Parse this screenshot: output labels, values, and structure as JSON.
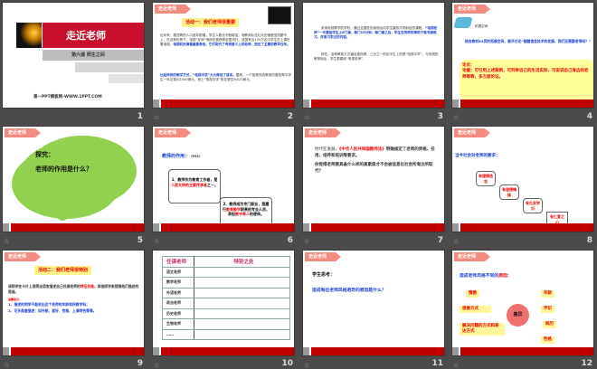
{
  "slide_numbers": [
    "1",
    "2",
    "3",
    "4",
    "5",
    "6",
    "7",
    "8",
    "9",
    "10",
    "11",
    "12"
  ],
  "section_tag": "走近老师",
  "s1": {
    "title": "走近老师",
    "subtitle": "第六课 师生之间",
    "footer": "第一PPT模板网-WWW.1PPT.COM"
  },
  "s2": {
    "heading": "活动一：我们老师很重要",
    "p1": "近年来，墨西哥的人口逐年剧增，学生人数也不断增加，而教师队伍壮大的速度显然跟不上。在这种形势下，电视“老师”悄然在墨西哥全国流行。该国有近130万名中学生在上课时看电视。",
    "p1b": "电视机扮演着重要角色，它们取代了传统意义上的老师，担任了主要的教学任务。",
    "p2b": "比起传统的教学方式，“电视中学”大大降低了成本。",
    "p2": "据悉，一个接受传统教育的墨西哥中学生一年花费约1000美元，而上“电视中学”的花费仅为525美元。"
  },
  "s3": {
    "p1": "采用电视教学的学校，通过全国性的电视台向学生播放不同科目的课程。",
    "p1b": "“电视老师”一天要给学生上6门课，每门15分钟，每门课之后，学生在导师的帮助下做书面练习，并复习学过的内容。",
    "p2": "现在，这种教育方式遍及墨西哥，三分之一的初中生上的是“电视中学”。与传统的教育相比，学生更喜欢“电视老师”。"
  },
  "s4": {
    "label": "拓展空间",
    "question": "结合教材64页的拓展空间，展开讨论“随着信息技术的发展，我们还需要老师吗？”",
    "point": "论点：",
    "evidence": "论据：可引用上述案例，可列举自己的生活实际，可说说自己身边的老师等等，多方面论证。"
  },
  "s5": {
    "line1": "探究：",
    "line2": "老师的作用是什么？"
  },
  "s6": {
    "heading": "教师的作用：",
    "ref": "（P61）",
    "box1a": "1、教师作为教育工作者，是",
    "box1r": "人类文明的主要传承者",
    "box1b": "之一。",
    "box2a": "2、教师成为专门职业，是履行",
    "box2r": "教育教学",
    "box2b": "职责的专业人员，承担",
    "box2r2": "教书育人",
    "box2c": "的使命。"
  },
  "s7": {
    "p1a": "时代在发展，",
    "p1r": "《中华人民共和国教师法》",
    "p1b": "明确规定了老师的资格、任用、培养和培训等要求。",
    "p2": "你觉得老师要具备什么样的高素质才不会被信息化社会所淘汰所取代？"
  },
  "s8": {
    "heading": "当今社会对老师的要求：",
    "items": [
      "有理想信念",
      "有道德情操",
      "有扎实学识",
      "有仁爱之心"
    ]
  },
  "s9": {
    "heading": "活动二：我们老师很特别",
    "p1a": "请同学在卡片上用简洁语言描述自己任课老师的",
    "p1r": "特征风格",
    "p1b": "，其他同学来猜猜他们描述的是谁。",
    "tip": "温馨提示：",
    "tip1": "1、描述的同学不能说出这个老师的年龄和所教学科；",
    "tip2": "2、可多角度描述：如外貌、爱好、性格、上课特色等等。"
  },
  "s10": {
    "headers": [
      "任课老师",
      "特别之处"
    ],
    "rows": [
      "语文老师",
      "数学老师",
      "外语老师",
      "政治老师",
      "历史老师",
      "生物老师",
      "……"
    ]
  },
  "s11": {
    "label": "学生思考：",
    "question": "造成每位老师风格迥异的原因是什么？"
  },
  "s12": {
    "heading_a": "造成老师风格不同的",
    "heading_r": "原因",
    "heading_end": "：",
    "center": "差异",
    "left": [
      "情感",
      "思维方式",
      "解决问题的方式和表达方式"
    ],
    "right": [
      "年龄",
      "学识",
      "阅历",
      "性格"
    ]
  }
}
